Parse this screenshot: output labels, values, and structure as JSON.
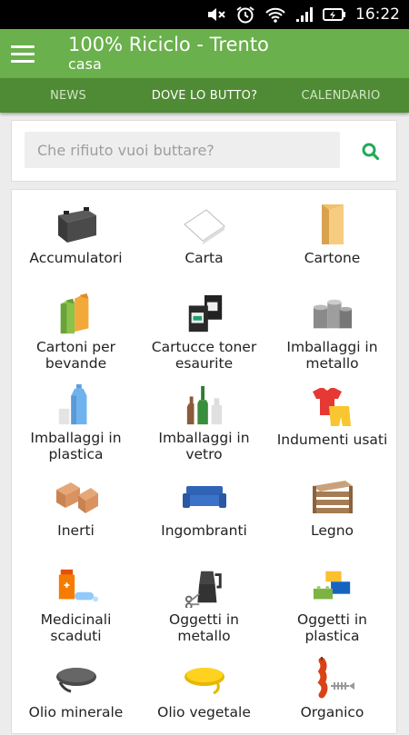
{
  "status": {
    "time": "16:22"
  },
  "app": {
    "title": "100% Riciclo - Trento",
    "subtitle": "casa"
  },
  "tabs": [
    {
      "label": "NEWS"
    },
    {
      "label": "DOVE LO BUTTO?"
    },
    {
      "label": "CALENDARIO"
    }
  ],
  "search": {
    "placeholder": "Che rifiuto vuoi buttare?"
  },
  "categories": [
    {
      "label": "Accumulatori",
      "icon": "battery-icon"
    },
    {
      "label": "Carta",
      "icon": "paper-icon"
    },
    {
      "label": "Cartone",
      "icon": "cardboard-icon"
    },
    {
      "label": "Cartoni per bevande",
      "icon": "drink-cartons-icon"
    },
    {
      "label": "Cartucce toner esaurite",
      "icon": "toner-cartridge-icon"
    },
    {
      "label": "Imballaggi in metallo",
      "icon": "metal-cans-icon"
    },
    {
      "label": "Imballaggi in plastica",
      "icon": "plastic-bottle-icon"
    },
    {
      "label": "Imballaggi in vetro",
      "icon": "glass-bottles-icon"
    },
    {
      "label": "Indumenti usati",
      "icon": "clothes-icon"
    },
    {
      "label": "Inerti",
      "icon": "bricks-icon"
    },
    {
      "label": "Ingombranti",
      "icon": "sofa-icon"
    },
    {
      "label": "Legno",
      "icon": "wooden-crate-icon"
    },
    {
      "label": "Medicinali scaduti",
      "icon": "medicine-icon"
    },
    {
      "label": "Oggetti in metallo",
      "icon": "moka-pot-icon"
    },
    {
      "label": "Oggetti in plastica",
      "icon": "plastic-blocks-icon"
    },
    {
      "label": "Olio minerale",
      "icon": "mineral-oil-icon"
    },
    {
      "label": "Olio vegetale",
      "icon": "vegetable-oil-icon"
    },
    {
      "label": "Organico",
      "icon": "organic-waste-icon"
    }
  ],
  "colors": {
    "appbar": "#6ab04c",
    "tabbar": "#4f8a34",
    "search_icon": "#22aa55"
  }
}
